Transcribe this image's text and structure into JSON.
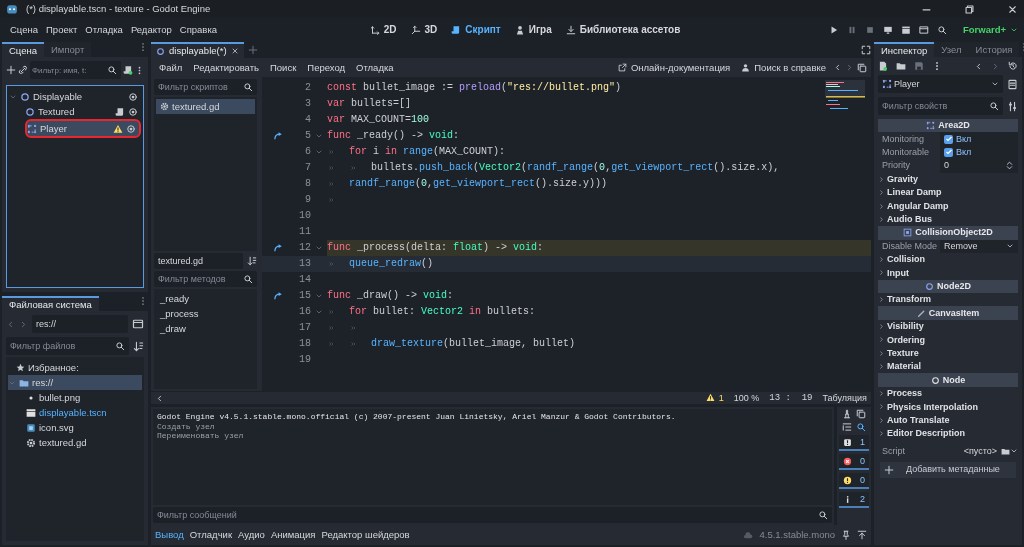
{
  "window": {
    "title": "(*) displayable.tscn - texture - Godot Engine"
  },
  "menu": [
    "Сцена",
    "Проект",
    "Отладка",
    "Редактор",
    "Справка"
  ],
  "workspaces": [
    {
      "label": "2D",
      "kind": "plane",
      "selected": false
    },
    {
      "label": "3D",
      "kind": "space",
      "selected": false
    },
    {
      "label": "Скрипт",
      "kind": "script",
      "selected": true
    },
    {
      "label": "Игра",
      "kind": "game",
      "selected": false
    },
    {
      "label": "Библиотека ассетов",
      "kind": "assetlib",
      "selected": false
    }
  ],
  "renderer": "Forward+",
  "scene_dock": {
    "tabs": [
      {
        "label": "Сцена",
        "selected": true
      },
      {
        "label": "Импорт",
        "selected": false
      }
    ],
    "filter": {
      "placeholder": "Фильтр: имя, t:"
    },
    "tree": [
      {
        "label": "Displayable",
        "kind": "node",
        "selected": false,
        "expanded": true,
        "visible": true,
        "script": false,
        "warning": false,
        "circled": false,
        "children": [
          {
            "label": "Textured",
            "kind": "node",
            "selected": false,
            "visible": true,
            "script": true,
            "warning": false,
            "circled": false
          },
          {
            "label": "Player",
            "kind": "area",
            "selected": true,
            "visible": true,
            "script": false,
            "warning": true,
            "circled": true
          }
        ]
      }
    ]
  },
  "filesystem": {
    "tabs": [
      {
        "label": "Файловая система",
        "selected": true
      }
    ],
    "path": "res://",
    "filter": {
      "placeholder": "Фильтр файлов"
    },
    "favorites": "Избранное:",
    "tree": [
      {
        "label": "res://",
        "kind": "folder",
        "selected": true,
        "expanded": true,
        "open": false,
        "children": [
          {
            "label": "bullet.png",
            "kind": "dot",
            "selected": false,
            "open": false
          },
          {
            "label": "displayable.tscn",
            "kind": "scene",
            "selected": false,
            "open": true
          },
          {
            "label": "icon.svg",
            "kind": "image",
            "selected": false,
            "open": false
          },
          {
            "label": "textured.gd",
            "kind": "gear",
            "selected": false,
            "open": false
          }
        ]
      }
    ]
  },
  "editor": {
    "tabs": [
      {
        "label": "displayable(*)",
        "selected": true
      }
    ],
    "menu": [
      "Файл",
      "Редактировать",
      "Поиск",
      "Переход",
      "Отладка"
    ],
    "links": [
      {
        "label": "Онлайн-документация",
        "kind": "external"
      },
      {
        "label": "Поиск в справке",
        "kind": "help"
      }
    ],
    "scripts_filter": {
      "placeholder": "Фильтр скриптов"
    },
    "scripts": [
      {
        "label": "textured.gd",
        "selected": true
      }
    ],
    "current_script": "textured.gd",
    "methods_filter": {
      "placeholder": "Фильтр методов"
    },
    "methods": [
      "_ready",
      "_process",
      "_draw"
    ],
    "lines": [
      {
        "number": "2",
        "override": false,
        "foldable": false,
        "highlighted": false,
        "selected": false,
        "tokens": [
          {
            "kind": "keyword",
            "text": "const"
          },
          {
            "kind": "text",
            "text": " bullet_image := "
          },
          {
            "kind": "builtin",
            "text": "preload"
          },
          {
            "kind": "text",
            "text": "("
          },
          {
            "kind": "string",
            "text": "\"res://bullet.png\""
          },
          {
            "kind": "text",
            "text": ")"
          }
        ]
      },
      {
        "number": "3",
        "override": false,
        "foldable": false,
        "highlighted": false,
        "selected": false,
        "tokens": [
          {
            "kind": "keyword",
            "text": "var"
          },
          {
            "kind": "text",
            "text": " bullets=[]"
          }
        ]
      },
      {
        "number": "4",
        "override": false,
        "foldable": false,
        "highlighted": false,
        "selected": false,
        "tokens": [
          {
            "kind": "keyword",
            "text": "var"
          },
          {
            "kind": "text",
            "text": " MAX_COUNT="
          },
          {
            "kind": "number",
            "text": "100"
          }
        ]
      },
      {
        "number": "5",
        "override": true,
        "foldable": true,
        "highlighted": false,
        "selected": false,
        "tokens": [
          {
            "kind": "keyword",
            "text": "func"
          },
          {
            "kind": "text",
            "text": " _ready() -> "
          },
          {
            "kind": "type",
            "text": "void"
          },
          {
            "kind": "text",
            "text": ":"
          }
        ]
      },
      {
        "number": "6",
        "kind": "inner",
        "override": false,
        "foldable": true,
        "highlighted": false,
        "selected": false,
        "tokens": [
          {
            "kind": "keyword",
            "text": "for"
          },
          {
            "kind": "text",
            "text": " i "
          },
          {
            "kind": "keyword",
            "text": "in "
          },
          {
            "kind": "func",
            "text": "range"
          },
          {
            "kind": "text",
            "text": "(MAX_COUNT):"
          }
        ]
      },
      {
        "number": "7",
        "kind": "deep",
        "override": false,
        "foldable": false,
        "highlighted": false,
        "selected": false,
        "tokens": [
          {
            "kind": "text",
            "text": "bullets."
          },
          {
            "kind": "func",
            "text": "push_back"
          },
          {
            "kind": "text",
            "text": "("
          },
          {
            "kind": "type",
            "text": "Vector2"
          },
          {
            "kind": "text",
            "text": "("
          },
          {
            "kind": "func",
            "text": "randf_range"
          },
          {
            "kind": "text",
            "text": "("
          },
          {
            "kind": "number",
            "text": "0"
          },
          {
            "kind": "text",
            "text": ","
          },
          {
            "kind": "func",
            "text": "get_viewport_rect"
          },
          {
            "kind": "text",
            "text": "().size.x),"
          }
        ]
      },
      {
        "number": "8",
        "kind": "inner",
        "override": false,
        "foldable": false,
        "highlighted": false,
        "selected": false,
        "tokens": [
          {
            "kind": "func",
            "text": "randf_range"
          },
          {
            "kind": "text",
            "text": "("
          },
          {
            "kind": "number",
            "text": "0"
          },
          {
            "kind": "text",
            "text": ","
          },
          {
            "kind": "func",
            "text": "get_viewport_rect"
          },
          {
            "kind": "text",
            "text": "().size.y)))"
          }
        ]
      },
      {
        "number": "9",
        "kind": "inner",
        "override": false,
        "foldable": false,
        "highlighted": false,
        "selected": false
      },
      {
        "number": "10",
        "override": false,
        "foldable": false,
        "highlighted": false,
        "selected": false
      },
      {
        "number": "11",
        "override": false,
        "foldable": false,
        "highlighted": false,
        "selected": false
      },
      {
        "number": "12",
        "override": true,
        "foldable": true,
        "highlighted": true,
        "selected": false,
        "tokens": [
          {
            "kind": "keyword",
            "text": "func"
          },
          {
            "kind": "text",
            "text": " _process(delta: "
          },
          {
            "kind": "type",
            "text": "float"
          },
          {
            "kind": "text",
            "text": ") -> "
          },
          {
            "kind": "type",
            "text": "void"
          },
          {
            "kind": "text",
            "text": ":"
          }
        ]
      },
      {
        "number": "13",
        "kind": "inner",
        "override": false,
        "foldable": false,
        "highlighted": false,
        "selected": true,
        "tokens": [
          {
            "kind": "func",
            "text": "queue_redraw"
          },
          {
            "kind": "text",
            "text": "()"
          }
        ]
      },
      {
        "number": "14",
        "override": false,
        "foldable": false,
        "highlighted": false,
        "selected": false
      },
      {
        "number": "15",
        "override": true,
        "foldable": true,
        "highlighted": false,
        "selected": false,
        "tokens": [
          {
            "kind": "keyword",
            "text": "func"
          },
          {
            "kind": "text",
            "text": " _draw() -> "
          },
          {
            "kind": "type",
            "text": "void"
          },
          {
            "kind": "text",
            "text": ":"
          }
        ]
      },
      {
        "number": "16",
        "kind": "inner",
        "override": false,
        "foldable": true,
        "highlighted": false,
        "selected": false,
        "tokens": [
          {
            "kind": "keyword",
            "text": "for"
          },
          {
            "kind": "text",
            "text": " bullet: "
          },
          {
            "kind": "type",
            "text": "Vector2 "
          },
          {
            "kind": "keyword",
            "text": "in"
          },
          {
            "kind": "text",
            "text": " bullets:"
          }
        ]
      },
      {
        "number": "17",
        "kind": "deep",
        "override": false,
        "foldable": false,
        "highlighted": false,
        "selected": false
      },
      {
        "number": "18",
        "kind": "deep",
        "override": false,
        "foldable": false,
        "highlighted": false,
        "selected": false,
        "tokens": [
          {
            "kind": "func",
            "text": "draw_texture"
          },
          {
            "kind": "text",
            "text": "(bullet_image, bullet)"
          }
        ]
      },
      {
        "number": "19",
        "override": false,
        "foldable": false,
        "highlighted": false,
        "selected": false
      }
    ],
    "status": {
      "warnings": "1",
      "zoom": "100 %",
      "caret": "13 :  19",
      "indent_mode": "Табуляция"
    }
  },
  "output": {
    "lines": [
      {
        "kind": "info",
        "text": "Godot Engine v4.5.1.stable.mono.official (c) 2007-present Juan Linietsky, Ariel Manzur & Godot Contributors."
      },
      {
        "kind": "dim",
        "text": "Создать узел"
      },
      {
        "kind": "dim",
        "text": "Переименовать узел"
      }
    ],
    "filter": {
      "placeholder": "Фильтр сообщений"
    },
    "counters": [
      {
        "kind": "message",
        "count": "1"
      },
      {
        "kind": "error",
        "count": "0"
      },
      {
        "kind": "warning",
        "count": "0"
      },
      {
        "kind": "info",
        "count": "2"
      }
    ],
    "tabs": [
      {
        "label": "Вывод",
        "selected": true
      },
      {
        "label": "Отладчик",
        "selected": false
      },
      {
        "label": "Аудио",
        "selected": false
      },
      {
        "label": "Анимация",
        "selected": false
      },
      {
        "label": "Редактор шейдеров",
        "selected": false
      }
    ],
    "version": "4.5.1.stable.mono"
  },
  "inspector": {
    "tabs": [
      {
        "label": "Инспектор",
        "selected": true
      },
      {
        "label": "Узел",
        "selected": false
      },
      {
        "label": "История",
        "selected": false
      }
    ],
    "node": "Player",
    "filter": {
      "placeholder": "Фильтр свойств"
    },
    "rows": [
      {
        "kind": "area",
        "label": "Area2D"
      },
      {
        "kind": "check",
        "label": "Monitoring",
        "value": "Вкл",
        "checked": true
      },
      {
        "kind": "check",
        "label": "Monitorable",
        "value": "Вкл",
        "checked": true
      },
      {
        "kind": "spin",
        "label": "Priority",
        "value": "0"
      },
      {
        "kind": "group",
        "label": "Gravity"
      },
      {
        "kind": "group",
        "label": "Linear Damp"
      },
      {
        "kind": "group",
        "label": "Angular Damp"
      },
      {
        "kind": "group",
        "label": "Audio Bus"
      },
      {
        "kind": "collision",
        "label": "CollisionObject2D"
      },
      {
        "kind": "select",
        "label": "Disable Mode",
        "value": "Remove"
      },
      {
        "kind": "group",
        "label": "Collision"
      },
      {
        "kind": "group",
        "label": "Input"
      },
      {
        "kind": "node2d",
        "label": "Node2D"
      },
      {
        "kind": "group",
        "label": "Transform"
      },
      {
        "kind": "canvasitem",
        "label": "CanvasItem"
      },
      {
        "kind": "group",
        "label": "Visibility"
      },
      {
        "kind": "group",
        "label": "Ordering"
      },
      {
        "kind": "group",
        "label": "Texture"
      },
      {
        "kind": "group",
        "label": "Material"
      },
      {
        "kind": "node",
        "label": "Node"
      },
      {
        "kind": "group",
        "label": "Process"
      },
      {
        "kind": "group",
        "label": "Physics Interpolation"
      },
      {
        "kind": "group",
        "label": "Auto Translate"
      },
      {
        "kind": "group",
        "label": "Editor Description"
      },
      {
        "kind": "resource",
        "label": "Script",
        "value": "<пусто>"
      }
    ],
    "add_button": "Добавить метаданные"
  }
}
